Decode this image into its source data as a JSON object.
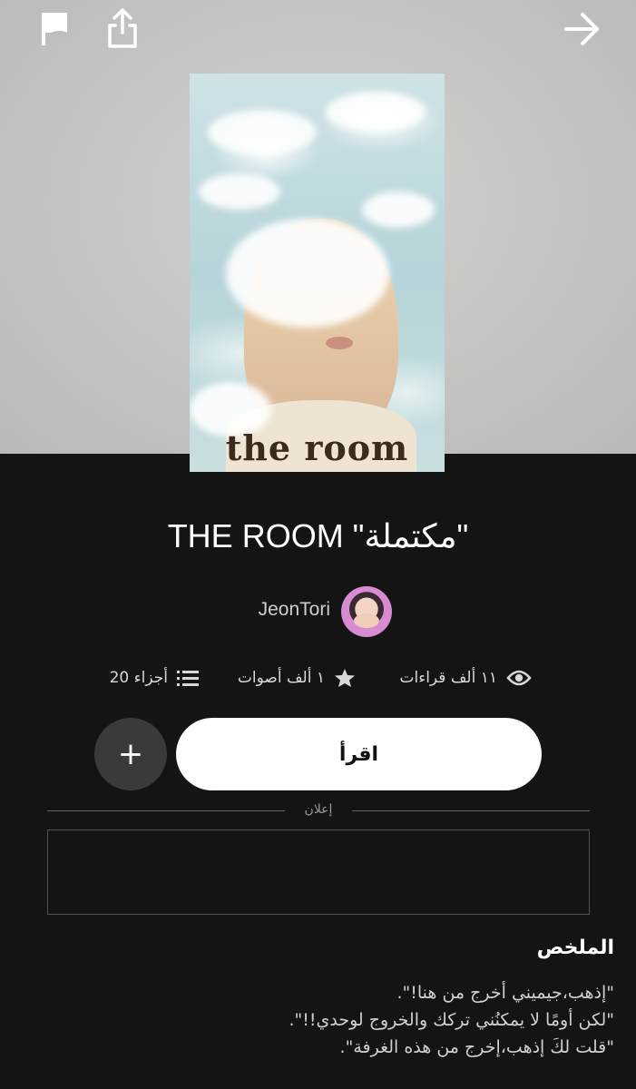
{
  "topbar": {
    "left_icons": [
      "flag-icon",
      "share-icon"
    ],
    "right_icon": "arrow-right-icon"
  },
  "cover": {
    "title_text": "the room"
  },
  "story": {
    "title": "THE ROOM \"مكتملة\"",
    "author": "JeonTori"
  },
  "stats": {
    "reads": "١١ ألف قراءات",
    "votes": "١ ألف أصوات",
    "parts": "20 أجزاء"
  },
  "actions": {
    "read_label": "اقرأ",
    "add_label": "+"
  },
  "ad": {
    "label": "إعلان"
  },
  "summary": {
    "heading": "الملخص",
    "lines": [
      "\"إذهب،جيميني أخرج من هنا!\".",
      "\"لكن أومًا لا يمكنُني تركك والخروج لوحدي!!\".",
      "\"قلت لكَ إذهب،إخرج من هذه الغرفة\"."
    ]
  },
  "colors": {
    "background": "#141414",
    "hero_background": "#c6c6c4",
    "read_button": "#ffffff",
    "add_button": "#3a3a3a"
  }
}
